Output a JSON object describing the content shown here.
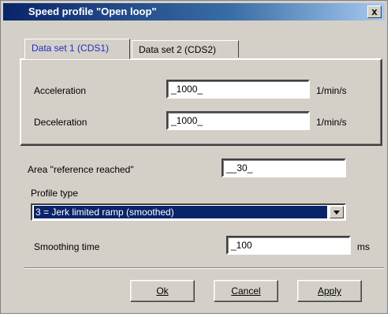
{
  "window": {
    "title": "Speed profile \"Open loop\"",
    "close_label": "x"
  },
  "tabs": [
    {
      "label": "Data set 1 (CDS1)",
      "active": true
    },
    {
      "label": "Data set 2 (CDS2)",
      "active": false
    }
  ],
  "acceleration": {
    "label": "Acceleration",
    "value": "_1000_",
    "unit": "1/min/s"
  },
  "deceleration": {
    "label": "Deceleration",
    "value": "_1000_",
    "unit": "1/min/s"
  },
  "area_reference": {
    "label": "Area \"reference reached\"",
    "value": "__30_"
  },
  "profile_type": {
    "label": "Profile type",
    "selected": "3 = Jerk limited ramp (smoothed)"
  },
  "smoothing": {
    "label": "Smoothing time",
    "value": "_100",
    "unit": "ms"
  },
  "buttons": {
    "ok": "Ok",
    "cancel": "Cancel",
    "apply": "Apply"
  },
  "colors": {
    "face": "#d4d0c8",
    "title_start": "#0a246a",
    "selection": "#0a246a",
    "active_tab_text": "#1d2fc4"
  }
}
